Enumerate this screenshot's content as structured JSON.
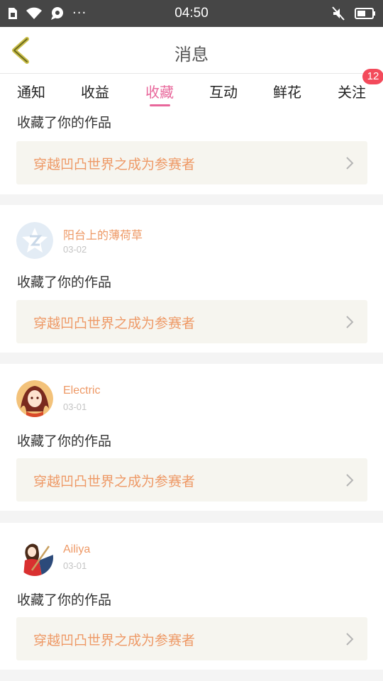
{
  "status_bar": {
    "time": "04:50",
    "dots": "···"
  },
  "header": {
    "title": "消息"
  },
  "tabs": [
    {
      "label": "通知"
    },
    {
      "label": "收益"
    },
    {
      "label": "收藏"
    },
    {
      "label": "互动"
    },
    {
      "label": "鲜花"
    },
    {
      "label": "关注"
    }
  ],
  "tab_badge": "12",
  "colors": {
    "accent_pink": "#e8679b",
    "username_orange": "#ee9966",
    "badge_red": "#f34a5b",
    "status_bar_bg": "#464646"
  },
  "items": [
    {
      "username": "",
      "date": "",
      "action": "收藏了你的作品",
      "work_title": "穿越凹凸世界之成为参赛者"
    },
    {
      "username": "阳台上的薄荷草",
      "date": "03-02",
      "action": "收藏了你的作品",
      "work_title": "穿越凹凸世界之成为参赛者",
      "avatar": "default-avatar-icon"
    },
    {
      "username": "Electric",
      "date": "03-01",
      "action": "收藏了你的作品",
      "work_title": "穿越凹凸世界之成为参赛者",
      "avatar": "anime-girl-avatar"
    },
    {
      "username": "Ailiya",
      "date": "03-01",
      "action": "收藏了你的作品",
      "work_title": "穿越凹凸世界之成为参赛者",
      "avatar": "girl-guitar-avatar"
    }
  ]
}
